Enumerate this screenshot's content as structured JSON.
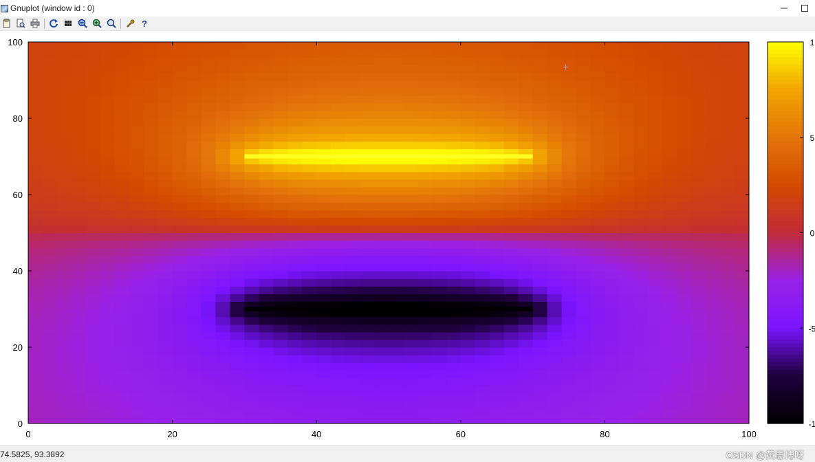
{
  "window": {
    "title": "Gnuplot (window id : 0)",
    "minimize_glyph": "—",
    "maximize_glyph": "□"
  },
  "toolbar": {
    "buttons": [
      {
        "name": "copy-to-clipboard-icon"
      },
      {
        "name": "print-preview-icon"
      },
      {
        "name": "print-icon"
      },
      {
        "name": "replot-icon"
      },
      {
        "name": "grid-icon"
      },
      {
        "name": "zoom-previous-icon"
      },
      {
        "name": "zoom-next-icon"
      },
      {
        "name": "unzoom-icon"
      },
      {
        "name": "options-icon"
      },
      {
        "name": "help-icon"
      }
    ],
    "help_glyph": "?"
  },
  "status": {
    "coords": "74.5825,  93.3892"
  },
  "watermark": "CSDN @黄思博呀",
  "colors": {
    "palette_stops": [
      "#000000",
      "#1e003c",
      "#7a14ff",
      "#9a21e6",
      "#c12a3a",
      "#d44a00",
      "#e3750a",
      "#f2a400",
      "#ffff00"
    ],
    "line_top": "#ffff22",
    "line_bottom": "#000000"
  },
  "chart_data": {
    "type": "heatmap",
    "title": "",
    "xlabel": "",
    "ylabel": "",
    "xlim": [
      0,
      100
    ],
    "ylim": [
      0,
      100
    ],
    "x_ticks": [
      "0",
      "20",
      "40",
      "60",
      "80",
      "100"
    ],
    "y_ticks": [
      "0",
      "20",
      "40",
      "60",
      "80",
      "100"
    ],
    "colorbar_tick_labels": [
      "1",
      "5",
      "0",
      "-5",
      "-1"
    ],
    "grid": false,
    "plates": [
      {
        "x_start": 30,
        "x_end": 70,
        "y": 70,
        "extreme": "max"
      },
      {
        "x_start": 30,
        "x_end": 70,
        "y": 30,
        "extreme": "min"
      }
    ],
    "cursor_marker": {
      "x": 74.5825,
      "y": 93.3892
    }
  }
}
